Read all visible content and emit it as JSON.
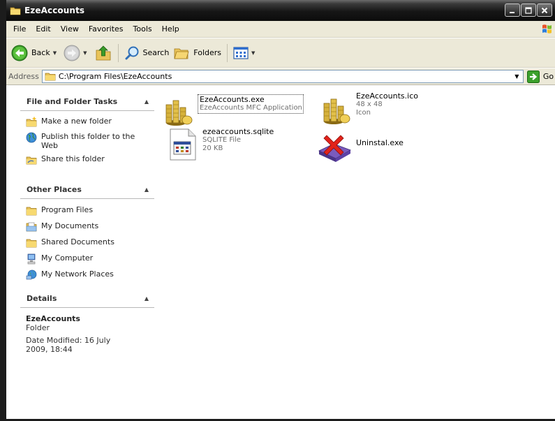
{
  "window": {
    "title": "EzeAccounts"
  },
  "menu": [
    "File",
    "Edit",
    "View",
    "Favorites",
    "Tools",
    "Help"
  ],
  "toolbar": {
    "back_label": "Back",
    "search_label": "Search",
    "folders_label": "Folders"
  },
  "address": {
    "label": "Address",
    "path": "C:\\Program Files\\EzeAccounts",
    "go_label": "Go"
  },
  "tasks_panel": {
    "title": "File and Folder Tasks",
    "items": [
      "Make a new folder",
      "Publish this folder to the Web",
      "Share this folder"
    ]
  },
  "places_panel": {
    "title": "Other Places",
    "items": [
      "Program Files",
      "My Documents",
      "Shared Documents",
      "My Computer",
      "My Network Places"
    ]
  },
  "details_panel": {
    "title": "Details",
    "name": "EzeAccounts",
    "type": "Folder",
    "modified": "Date Modified: 16 July 2009, 18:44"
  },
  "files": [
    {
      "name": "EzeAccounts.exe",
      "line1": "EzeAccounts MFC Application",
      "line2": "",
      "icon": "coins-app-icon",
      "selected": true
    },
    {
      "name": "EzeAccounts.ico",
      "line1": "48 x 48",
      "line2": "Icon",
      "icon": "coins-icon"
    },
    {
      "name": "ezeaccounts.sqlite",
      "line1": "SQLITE File",
      "line2": "20 KB",
      "icon": "sqlite-file-icon"
    },
    {
      "name": "Uninstal.exe",
      "line1": "",
      "line2": "",
      "icon": "uninstall-icon"
    }
  ]
}
